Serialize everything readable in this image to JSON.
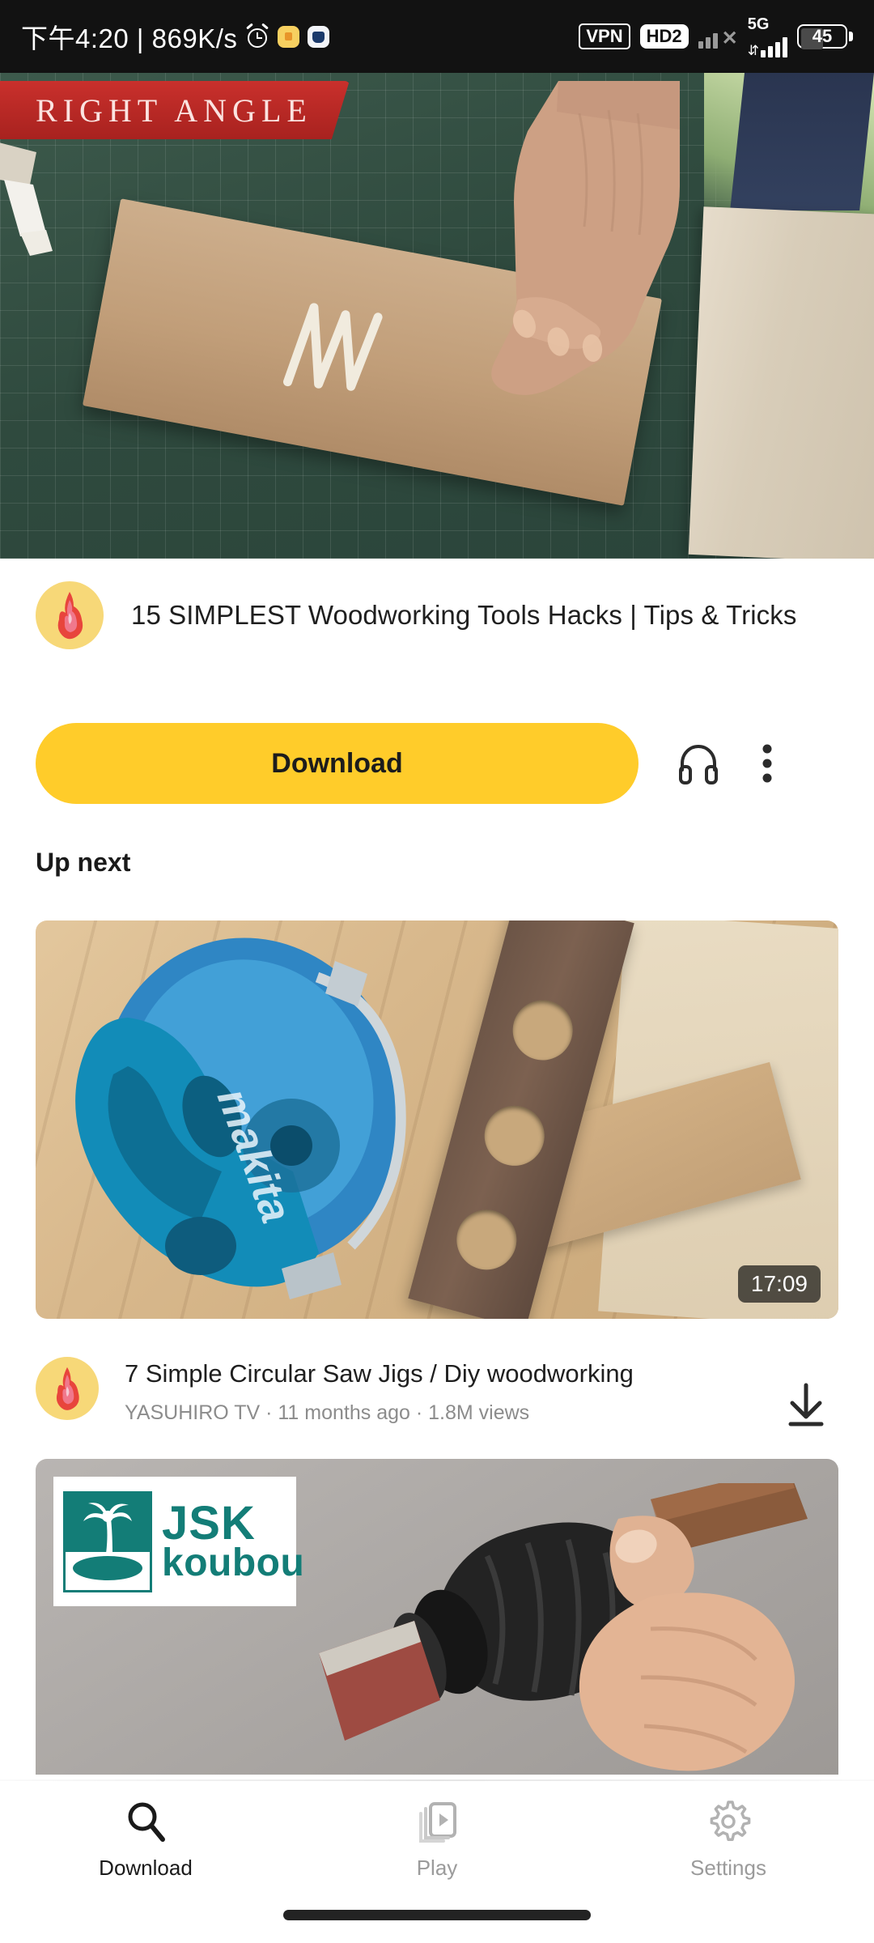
{
  "status_bar": {
    "clock": "下午4:20 | 869K/s",
    "icons_left": [
      "alarm-clock-icon",
      "yellow-app-icon",
      "blue-cat-app-icon"
    ],
    "vpn_label": "VPN",
    "hd_label": "HD2",
    "network_label": "5G",
    "battery_level": "45",
    "battery_percent": 45
  },
  "player": {
    "banner_text": "RIGHT ANGLE",
    "scene": "hand-pressing-glued-board-on-green-cutting-mat"
  },
  "video": {
    "title": "15 SIMPLEST Woodworking Tools Hacks | Tips & Tricks",
    "avatar": "yasuhiro-tv-flame-avatar"
  },
  "actions": {
    "download_label": "Download",
    "headphones_icon": "headphones-icon",
    "more_icon": "more-vertical-icon"
  },
  "up_next": {
    "heading": "Up next",
    "items": [
      {
        "title": "7 Simple Circular Saw Jigs  / Diy woodworking",
        "channel": "YASUHIRO TV",
        "age": "11 months ago",
        "views": "1.8M views",
        "meta_line": "YASUHIRO TV  ·  11 months ago  ·  1.8M views",
        "duration": "17:09",
        "thumbnail": "makita-circular-saw-and-walnut-jig-on-wood",
        "download_icon": "download-arrow-icon"
      },
      {
        "title": "",
        "channel": "JSK koubou",
        "logo_line1": "JSK",
        "logo_line2": "koubou",
        "thumbnail": "hand-holding-sanding-power-tool"
      }
    ]
  },
  "bottom_nav": {
    "items": [
      {
        "label": "Download",
        "icon": "search-icon",
        "active": true
      },
      {
        "label": "Play",
        "icon": "play-device-icon",
        "active": false
      },
      {
        "label": "Settings",
        "icon": "gear-icon",
        "active": false
      }
    ]
  },
  "colors": {
    "accent_yellow": "#ffcc2a",
    "status_bar_bg": "#121212",
    "banner_red": "#c9302c",
    "jsk_teal": "#137d77",
    "muted_text": "#8c8c8c"
  }
}
